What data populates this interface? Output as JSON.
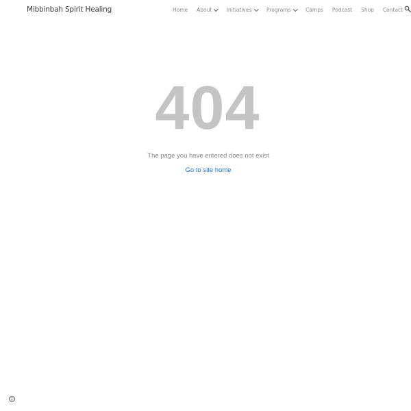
{
  "header": {
    "site_title": "Mibbinbah Spirit Healing",
    "nav": [
      {
        "label": "Home",
        "has_dropdown": false
      },
      {
        "label": "About",
        "has_dropdown": true
      },
      {
        "label": "Initiatives",
        "has_dropdown": true
      },
      {
        "label": "Programs",
        "has_dropdown": true
      },
      {
        "label": "Camps",
        "has_dropdown": false
      },
      {
        "label": "Podcast",
        "has_dropdown": false
      },
      {
        "label": "Shop",
        "has_dropdown": false
      },
      {
        "label": "Contact",
        "has_dropdown": false
      }
    ],
    "search_icon": "search-icon"
  },
  "main": {
    "error_code": "404",
    "message": "The page you have entered does not exist",
    "home_link": "Go to site home"
  },
  "footer": {
    "info_icon": "info-icon"
  },
  "colors": {
    "error_code": "#c4c4c4",
    "link": "#1a73e8",
    "nav_text": "#8a8a8a",
    "title_text": "#3c3c3c"
  }
}
